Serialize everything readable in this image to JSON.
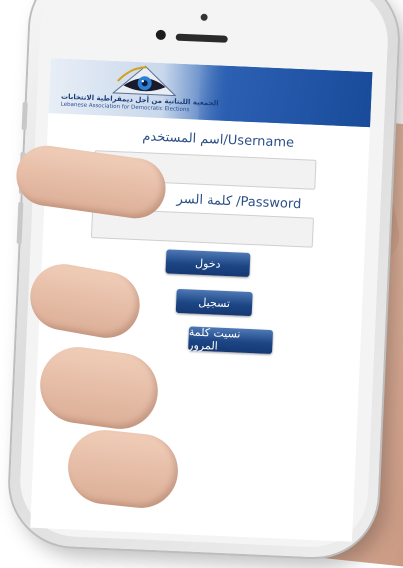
{
  "header": {
    "org_name_ar": "الجمعية اللبنانية من أجل ديمقراطية الانتخابات",
    "org_name_en": "Lebanese Association for Democratic Elections",
    "colors": {
      "banner_dark": "#1d4f9e",
      "banner_light": "#e8eef6"
    }
  },
  "form": {
    "username_label": "اسم المستخدم/Username",
    "username_value": "",
    "password_label": "كلمة السر /Password",
    "password_value": ""
  },
  "buttons": {
    "login": "دخول",
    "register": "تسجيل",
    "forgot": "نسيت كلمة المرور"
  },
  "icons": {
    "logo": "eye-triangle-logo-icon"
  },
  "colors": {
    "label": "#2b4f86",
    "button": "#1d4685"
  }
}
